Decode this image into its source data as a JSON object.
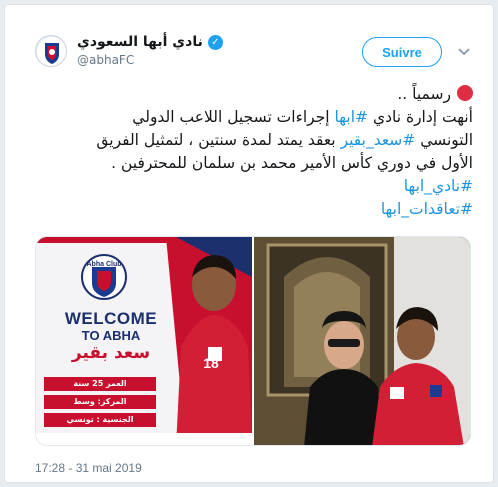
{
  "account": {
    "display_name": "نادي أبها السعودي",
    "handle": "@abhaFC",
    "verified_icon": "verified-badge-icon",
    "avatar_icon": "abha-club-logo-icon"
  },
  "follow_button": {
    "label": "Suivre"
  },
  "menu": {
    "icon": "chevron-down-icon"
  },
  "tweet": {
    "line1": "رسمياً ..",
    "line2_a": "أنهت إدارة نادي ",
    "line2_tag": "#ابها",
    "line2_b": " إجراءات تسجيل اللاعب الدولي",
    "line3_a": "التونسي ",
    "line3_tag": "#سعد_بقير",
    "line3_b": " بعقد يمتد لمدة سنتين ، لتمثيل الفريق",
    "line4": "الأول في دوري كأس الأمير محمد بن سلمان للمحترفين .",
    "hashtag1": "#نادي_ابها",
    "hashtag2": "#تعاقدات_ابها",
    "emoji": "red-circle-icon"
  },
  "poster": {
    "welcome": "WELCOME",
    "to_abha": "TO ABHA",
    "player_name": "سعد بقير",
    "age": "العمر 25 سنة",
    "position": "المركز: وسط",
    "nationality": "الجنسية : تونسي",
    "jersey_number": "18",
    "club_logo_text": "Abha Club"
  },
  "timestamp": "17:28 - 31 mai 2019",
  "colors": {
    "accent": "#1da1f2",
    "hashtag": "#1b95e0",
    "poster_red": "#c8102e",
    "poster_navy": "#1c2f6e"
  }
}
